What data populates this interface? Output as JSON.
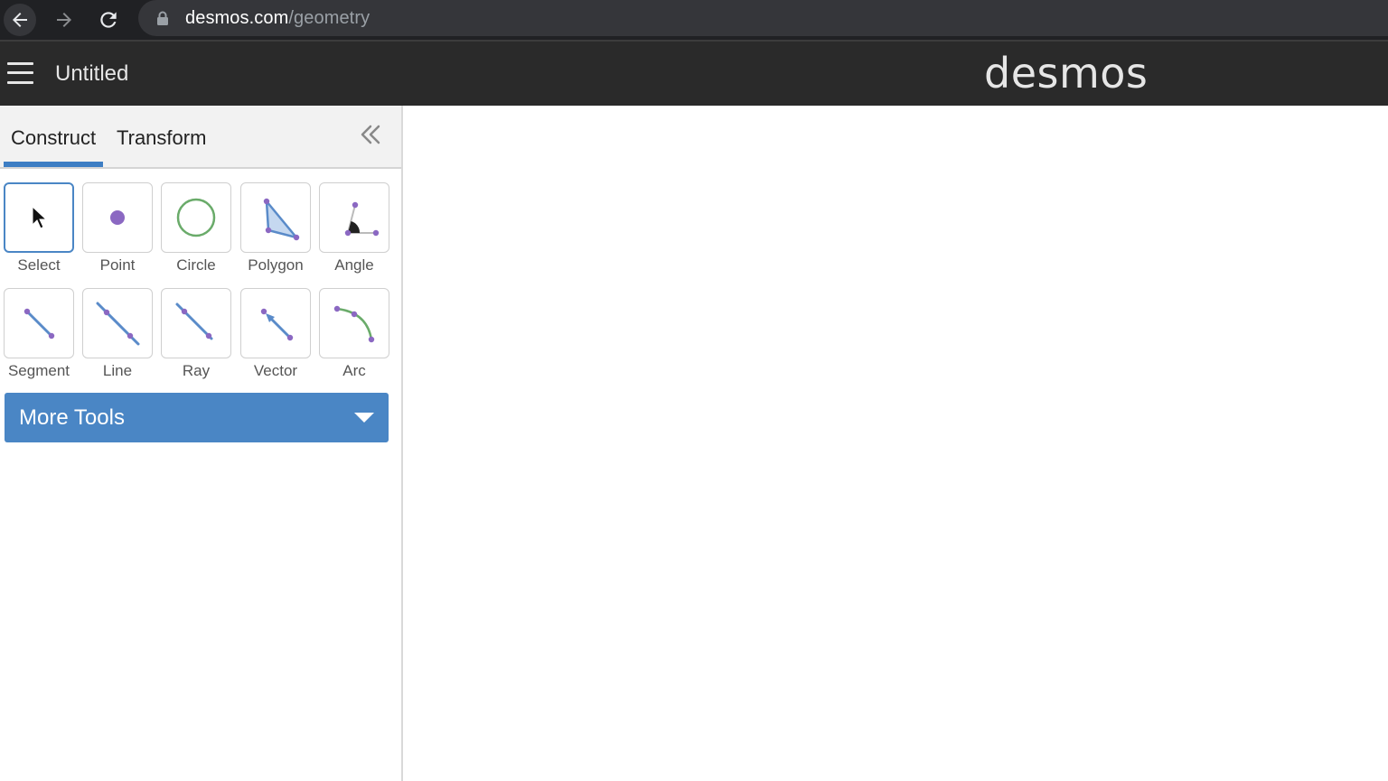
{
  "browser": {
    "url_domain": "desmos.com",
    "url_path": "/geometry",
    "icons": [
      "back-arrow-icon",
      "forward-arrow-icon",
      "reload-icon",
      "lock-icon"
    ]
  },
  "header": {
    "title": "Untitled",
    "brand": "desmos"
  },
  "tabs": {
    "construct": "Construct",
    "transform": "Transform",
    "active": "Construct"
  },
  "tools": {
    "row1": [
      "Select",
      "Point",
      "Circle",
      "Polygon",
      "Angle"
    ],
    "row2": [
      "Segment",
      "Line",
      "Ray",
      "Vector",
      "Arc"
    ]
  },
  "more_tools": {
    "label": "More Tools"
  },
  "colors": {
    "accent": "#4a86c5",
    "point": "#8b68c2",
    "circle": "#6aab6a",
    "line": "#5a8bc9"
  }
}
